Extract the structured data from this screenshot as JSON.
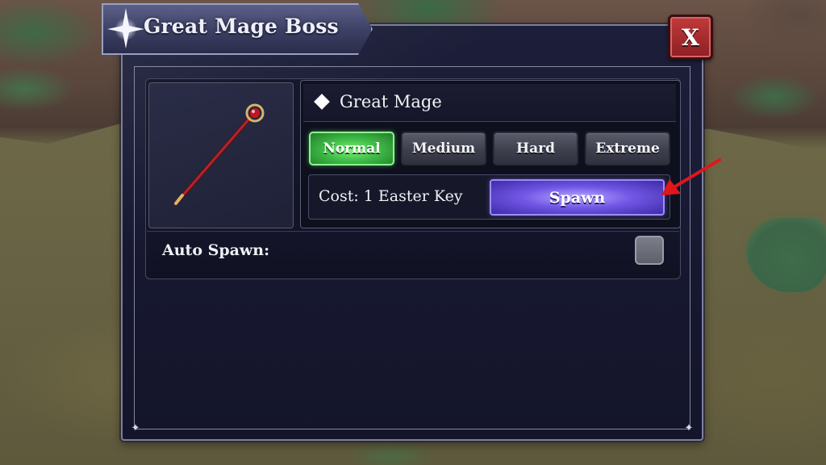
{
  "window": {
    "title": "Great Mage Boss",
    "close_label": "X"
  },
  "boss": {
    "name": "Great Mage",
    "item_icon": "mage-staff-icon"
  },
  "difficulty": {
    "selected": "Normal",
    "options": [
      "Normal",
      "Medium",
      "Hard",
      "Extreme"
    ]
  },
  "spawn": {
    "cost_text": "Cost: 1 Easter Key",
    "button_label": "Spawn"
  },
  "auto_spawn": {
    "label": "Auto Spawn:",
    "checked": false
  },
  "colors": {
    "selected_difficulty": "#3fbf47",
    "spawn_button": "#7257e6",
    "close_button": "#b3323a",
    "annotation_arrow": "#e0161b"
  }
}
